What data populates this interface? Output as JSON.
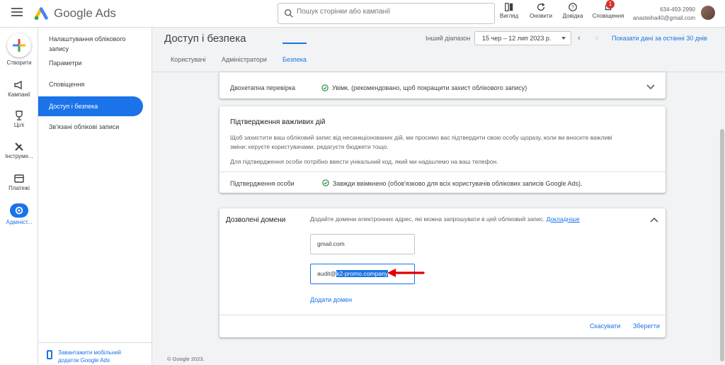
{
  "app": {
    "brand": "Google Ads"
  },
  "search": {
    "placeholder": "Пошук сторінки або кампанії"
  },
  "toolbar": {
    "view_label": "Вигляд",
    "refresh_label": "Оновити",
    "help_label": "Довідка",
    "notifications_label": "Сповіщення",
    "notifications_count": "1"
  },
  "account": {
    "id": "634-493-2990",
    "email": "anasteiha40@gmail.com"
  },
  "rail": {
    "create_label": "Створити",
    "items": [
      {
        "label": "Кампанії",
        "icon": "megaphone-icon"
      },
      {
        "label": "Цілі",
        "icon": "trophy-icon"
      },
      {
        "label": "Інструме...",
        "icon": "tools-icon"
      },
      {
        "label": "Платежі",
        "icon": "card-icon"
      },
      {
        "label": "Адмініст...",
        "icon": "gear-icon"
      }
    ]
  },
  "nav": {
    "items": [
      {
        "label": "Налаштування облікового запису"
      },
      {
        "label": "Параметри"
      },
      {
        "label": "Сповіщення"
      },
      {
        "label": "Доступ і безпека",
        "active": true
      },
      {
        "label": "Зв'язані облікові записи"
      }
    ],
    "footer": "Завантажити мобільний додаток Google Ads"
  },
  "header": {
    "title": "Доступ і безпека",
    "range_label": "Інший діапазон",
    "date_range": "15 чер – 12 лип 2023 р.",
    "show_last_30": "Показати дані за останні 30 днів"
  },
  "tabs": [
    {
      "label": "Користувачі"
    },
    {
      "label": "Адміністратори"
    },
    {
      "label": "Безпека",
      "active": true
    }
  ],
  "two_step": {
    "label": "Двохетапна перевірка",
    "status": "Увімк. (рекомендовано, щоб покращити захист облікового запису)"
  },
  "important": {
    "title": "Підтвердження важливих дій",
    "desc1": "Щоб захистити ваш обліковий запис від несанкціонованих дій, ми просимо вас підтвердити свою особу щоразу, коли ви вносите важливі",
    "desc1b": "зміни: керуєте користувачами, редагуєте бюджети тощо.",
    "desc2": "Для підтвердження особи потрібно ввести унікальний код, який ми надішлемо на ваш телефон.",
    "identity_label": "Підтвердження особи",
    "identity_status": "Завжди ввімкнено (обов'язково для всіх користувачів облікових записів Google Ads)."
  },
  "domains": {
    "title": "Дозволені домени",
    "desc": "Додайте домени електронних адрес, які можна запрошувати в цей обліковий запис.",
    "learn_more": "Докладніше",
    "domain1": "gmail.com",
    "domain2_prefix": "audit@",
    "domain2_selected": "k2-promo.company",
    "add_domain": "Додати домен",
    "cancel": "Скасувати",
    "save": "Зберегти"
  },
  "footer": {
    "copyright": "© Google 2023."
  },
  "colors": {
    "accent": "#1a73e8",
    "success": "#188038",
    "annotation": "#e00000"
  }
}
